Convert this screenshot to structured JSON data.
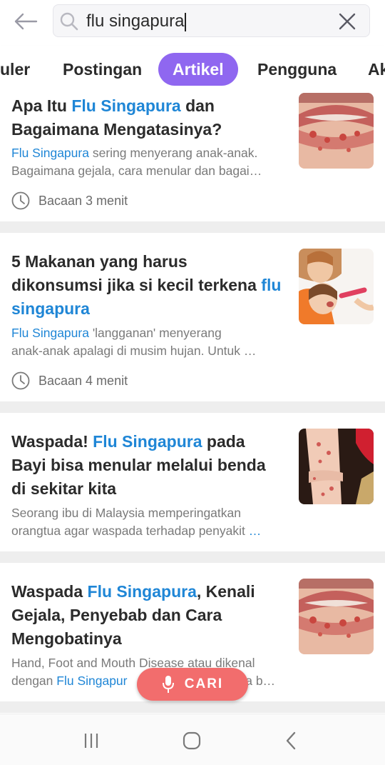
{
  "search": {
    "query": "flu singapura"
  },
  "tabs": [
    {
      "label": "uler"
    },
    {
      "label": "Postingan"
    },
    {
      "label": "Artikel"
    },
    {
      "label": "Pengguna"
    },
    {
      "label": "Ak"
    }
  ],
  "active_tab": "Artikel",
  "articles": [
    {
      "title_parts": [
        "Apa Itu ",
        "Flu Singapura",
        " dan Bagaimana Mengatasinya?"
      ],
      "snippet_line1_hl": "Flu Singapura",
      "snippet_line1_rest": " sering menyerang anak-anak.",
      "snippet_line2": "Bagaimana gejala, cara menular dan bagai…",
      "read_time": "Bacaan 3 menit",
      "image": "rash-on-lips-photo"
    },
    {
      "title_parts": [
        "5 Makanan yang harus dikonsumsi jika si kecil terkena ",
        "flu singapura",
        ""
      ],
      "snippet_line1_hl": "Flu Singapura",
      "snippet_line1_rest": " 'langganan' menyerang",
      "snippet_line2": "anak-anak apalagi di musim hujan. Untuk …",
      "read_time": "Bacaan 4 menit",
      "image": "mother-feeding-child-photo"
    },
    {
      "title_parts": [
        "Waspada! ",
        "Flu Singapura",
        " pada Bayi bisa menular melalui benda di sekitar kita"
      ],
      "snippet_line1": "Seorang ibu di Malaysia memperingatkan",
      "snippet_line2": "orangtua agar waspada terhadap penyakit ",
      "snippet_line2_ellipsis": "…",
      "image": "baby-arm-rash-photo"
    },
    {
      "title_parts": [
        "Waspada ",
        "Flu Singapura",
        ", Kenali Gejala, Penyebab dan Cara Mengobatinya"
      ],
      "snippet_line1": "Hand, Foot and Mouth Disease atau dikenal",
      "snippet_line2_pre": "dengan ",
      "snippet_line2_hl": "Flu Singapur",
      "snippet_line2_post": "da b…",
      "image": "rash-on-lips-photo"
    }
  ],
  "cari_label": "CARI",
  "colors": {
    "accent": "#8f67f0",
    "link": "#1f86d6",
    "cari": "#f26d6d"
  }
}
